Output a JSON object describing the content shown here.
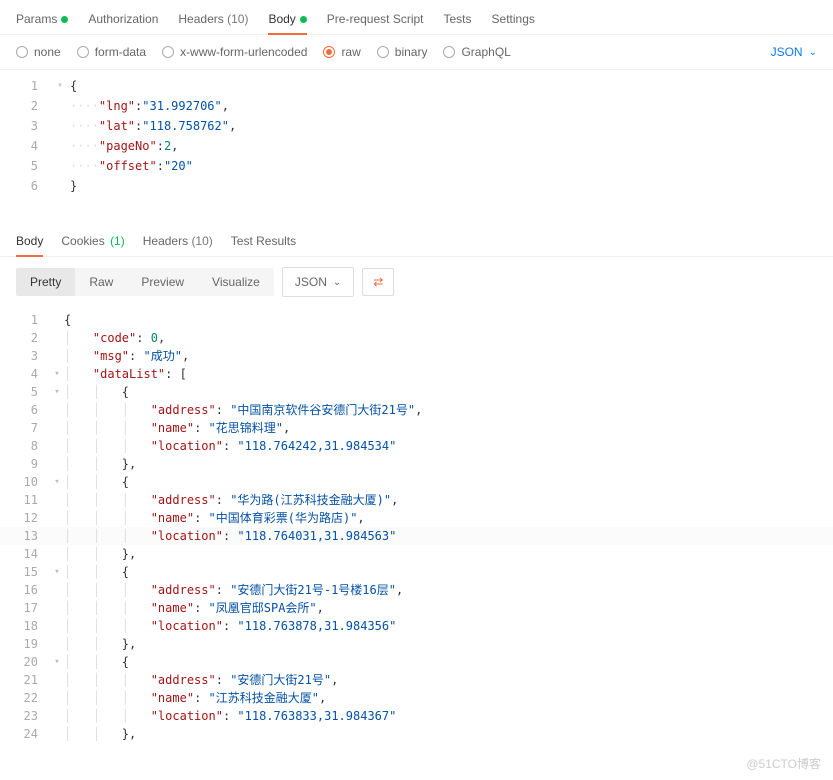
{
  "req_tabs": {
    "params": "Params",
    "auth": "Authorization",
    "headers": "Headers",
    "headers_count": "(10)",
    "body": "Body",
    "prereq": "Pre-request Script",
    "tests": "Tests",
    "settings": "Settings"
  },
  "body_types": {
    "none": "none",
    "formdata": "form-data",
    "urlenc": "x-www-form-urlencoded",
    "raw": "raw",
    "binary": "binary",
    "graphql": "GraphQL"
  },
  "format_select": "JSON",
  "req_body_lines": [
    {
      "n": "1",
      "pre": "",
      "seg": [
        {
          "c": "p",
          "t": "{"
        }
      ]
    },
    {
      "n": "2",
      "pre": "    ",
      "seg": [
        {
          "c": "k",
          "t": "\"lng\""
        },
        {
          "c": "p",
          "t": ":"
        },
        {
          "c": "s",
          "t": "\"31.992706\""
        },
        {
          "c": "p",
          "t": ","
        }
      ]
    },
    {
      "n": "3",
      "pre": "    ",
      "seg": [
        {
          "c": "k",
          "t": "\"lat\""
        },
        {
          "c": "p",
          "t": ":"
        },
        {
          "c": "s",
          "t": "\"118.758762\""
        },
        {
          "c": "p",
          "t": ","
        }
      ]
    },
    {
      "n": "4",
      "pre": "    ",
      "seg": [
        {
          "c": "k",
          "t": "\"pageNo\""
        },
        {
          "c": "p",
          "t": ":"
        },
        {
          "c": "n",
          "t": "2"
        },
        {
          "c": "p",
          "t": ","
        }
      ]
    },
    {
      "n": "5",
      "pre": "    ",
      "seg": [
        {
          "c": "k",
          "t": "\"offset\""
        },
        {
          "c": "p",
          "t": ":"
        },
        {
          "c": "s",
          "t": "\"20\""
        }
      ]
    },
    {
      "n": "6",
      "pre": "",
      "seg": [
        {
          "c": "p",
          "t": "}"
        }
      ]
    }
  ],
  "resp_tabs": {
    "body": "Body",
    "cookies": "Cookies",
    "cookies_count": "(1)",
    "headers": "Headers",
    "headers_count": "(10)",
    "tests": "Test Results"
  },
  "view_modes": {
    "pretty": "Pretty",
    "raw": "Raw",
    "preview": "Preview",
    "visualize": "Visualize"
  },
  "resp_format": "JSON",
  "resp_lines": [
    {
      "n": "1",
      "fold": "",
      "pre": "",
      "seg": [
        {
          "c": "p",
          "t": "{"
        }
      ]
    },
    {
      "n": "2",
      "fold": "",
      "pre": "    ",
      "seg": [
        {
          "c": "k",
          "t": "\"code\""
        },
        {
          "c": "p",
          "t": ": "
        },
        {
          "c": "n",
          "t": "0"
        },
        {
          "c": "p",
          "t": ","
        }
      ]
    },
    {
      "n": "3",
      "fold": "",
      "pre": "    ",
      "seg": [
        {
          "c": "k",
          "t": "\"msg\""
        },
        {
          "c": "p",
          "t": ": "
        },
        {
          "c": "s",
          "t": "\"成功\""
        },
        {
          "c": "p",
          "t": ","
        }
      ]
    },
    {
      "n": "4",
      "fold": "▾",
      "pre": "    ",
      "seg": [
        {
          "c": "k",
          "t": "\"dataList\""
        },
        {
          "c": "p",
          "t": ": ["
        }
      ]
    },
    {
      "n": "5",
      "fold": "▾",
      "pre": "        ",
      "seg": [
        {
          "c": "p",
          "t": "{"
        }
      ]
    },
    {
      "n": "6",
      "fold": "",
      "pre": "            ",
      "seg": [
        {
          "c": "k",
          "t": "\"address\""
        },
        {
          "c": "p",
          "t": ": "
        },
        {
          "c": "s",
          "t": "\"中国南京软件谷安德门大街21号\""
        },
        {
          "c": "p",
          "t": ","
        }
      ]
    },
    {
      "n": "7",
      "fold": "",
      "pre": "            ",
      "seg": [
        {
          "c": "k",
          "t": "\"name\""
        },
        {
          "c": "p",
          "t": ": "
        },
        {
          "c": "s",
          "t": "\"花思锦料理\""
        },
        {
          "c": "p",
          "t": ","
        }
      ]
    },
    {
      "n": "8",
      "fold": "",
      "pre": "            ",
      "seg": [
        {
          "c": "k",
          "t": "\"location\""
        },
        {
          "c": "p",
          "t": ": "
        },
        {
          "c": "s",
          "t": "\"118.764242,31.984534\""
        }
      ]
    },
    {
      "n": "9",
      "fold": "",
      "pre": "        ",
      "seg": [
        {
          "c": "p",
          "t": "},"
        }
      ]
    },
    {
      "n": "10",
      "fold": "▾",
      "pre": "        ",
      "seg": [
        {
          "c": "p",
          "t": "{"
        }
      ]
    },
    {
      "n": "11",
      "fold": "",
      "pre": "            ",
      "seg": [
        {
          "c": "k",
          "t": "\"address\""
        },
        {
          "c": "p",
          "t": ": "
        },
        {
          "c": "s",
          "t": "\"华为路(江苏科技金融大厦)\""
        },
        {
          "c": "p",
          "t": ","
        }
      ]
    },
    {
      "n": "12",
      "fold": "",
      "pre": "            ",
      "seg": [
        {
          "c": "k",
          "t": "\"name\""
        },
        {
          "c": "p",
          "t": ": "
        },
        {
          "c": "s",
          "t": "\"中国体育彩票(华为路店)\""
        },
        {
          "c": "p",
          "t": ","
        }
      ]
    },
    {
      "n": "13",
      "fold": "",
      "pre": "            ",
      "seg": [
        {
          "c": "k",
          "t": "\"location\""
        },
        {
          "c": "p",
          "t": ": "
        },
        {
          "c": "s",
          "t": "\"118.764031,31.984563\""
        }
      ],
      "hl": true
    },
    {
      "n": "14",
      "fold": "",
      "pre": "        ",
      "seg": [
        {
          "c": "p",
          "t": "},"
        }
      ]
    },
    {
      "n": "15",
      "fold": "▾",
      "pre": "        ",
      "seg": [
        {
          "c": "p",
          "t": "{"
        }
      ]
    },
    {
      "n": "16",
      "fold": "",
      "pre": "            ",
      "seg": [
        {
          "c": "k",
          "t": "\"address\""
        },
        {
          "c": "p",
          "t": ": "
        },
        {
          "c": "s",
          "t": "\"安德门大街21号-1号楼16层\""
        },
        {
          "c": "p",
          "t": ","
        }
      ]
    },
    {
      "n": "17",
      "fold": "",
      "pre": "            ",
      "seg": [
        {
          "c": "k",
          "t": "\"name\""
        },
        {
          "c": "p",
          "t": ": "
        },
        {
          "c": "s",
          "t": "\"凤凰官邸SPA会所\""
        },
        {
          "c": "p",
          "t": ","
        }
      ]
    },
    {
      "n": "18",
      "fold": "",
      "pre": "            ",
      "seg": [
        {
          "c": "k",
          "t": "\"location\""
        },
        {
          "c": "p",
          "t": ": "
        },
        {
          "c": "s",
          "t": "\"118.763878,31.984356\""
        }
      ]
    },
    {
      "n": "19",
      "fold": "",
      "pre": "        ",
      "seg": [
        {
          "c": "p",
          "t": "},"
        }
      ]
    },
    {
      "n": "20",
      "fold": "▾",
      "pre": "        ",
      "seg": [
        {
          "c": "p",
          "t": "{"
        }
      ]
    },
    {
      "n": "21",
      "fold": "",
      "pre": "            ",
      "seg": [
        {
          "c": "k",
          "t": "\"address\""
        },
        {
          "c": "p",
          "t": ": "
        },
        {
          "c": "s",
          "t": "\"安德门大街21号\""
        },
        {
          "c": "p",
          "t": ","
        }
      ]
    },
    {
      "n": "22",
      "fold": "",
      "pre": "            ",
      "seg": [
        {
          "c": "k",
          "t": "\"name\""
        },
        {
          "c": "p",
          "t": ": "
        },
        {
          "c": "s",
          "t": "\"江苏科技金融大厦\""
        },
        {
          "c": "p",
          "t": ","
        }
      ]
    },
    {
      "n": "23",
      "fold": "",
      "pre": "            ",
      "seg": [
        {
          "c": "k",
          "t": "\"location\""
        },
        {
          "c": "p",
          "t": ": "
        },
        {
          "c": "s",
          "t": "\"118.763833,31.984367\""
        }
      ]
    },
    {
      "n": "24",
      "fold": "",
      "pre": "        ",
      "seg": [
        {
          "c": "p",
          "t": "},"
        }
      ]
    }
  ],
  "watermark": "@51CTO博客"
}
